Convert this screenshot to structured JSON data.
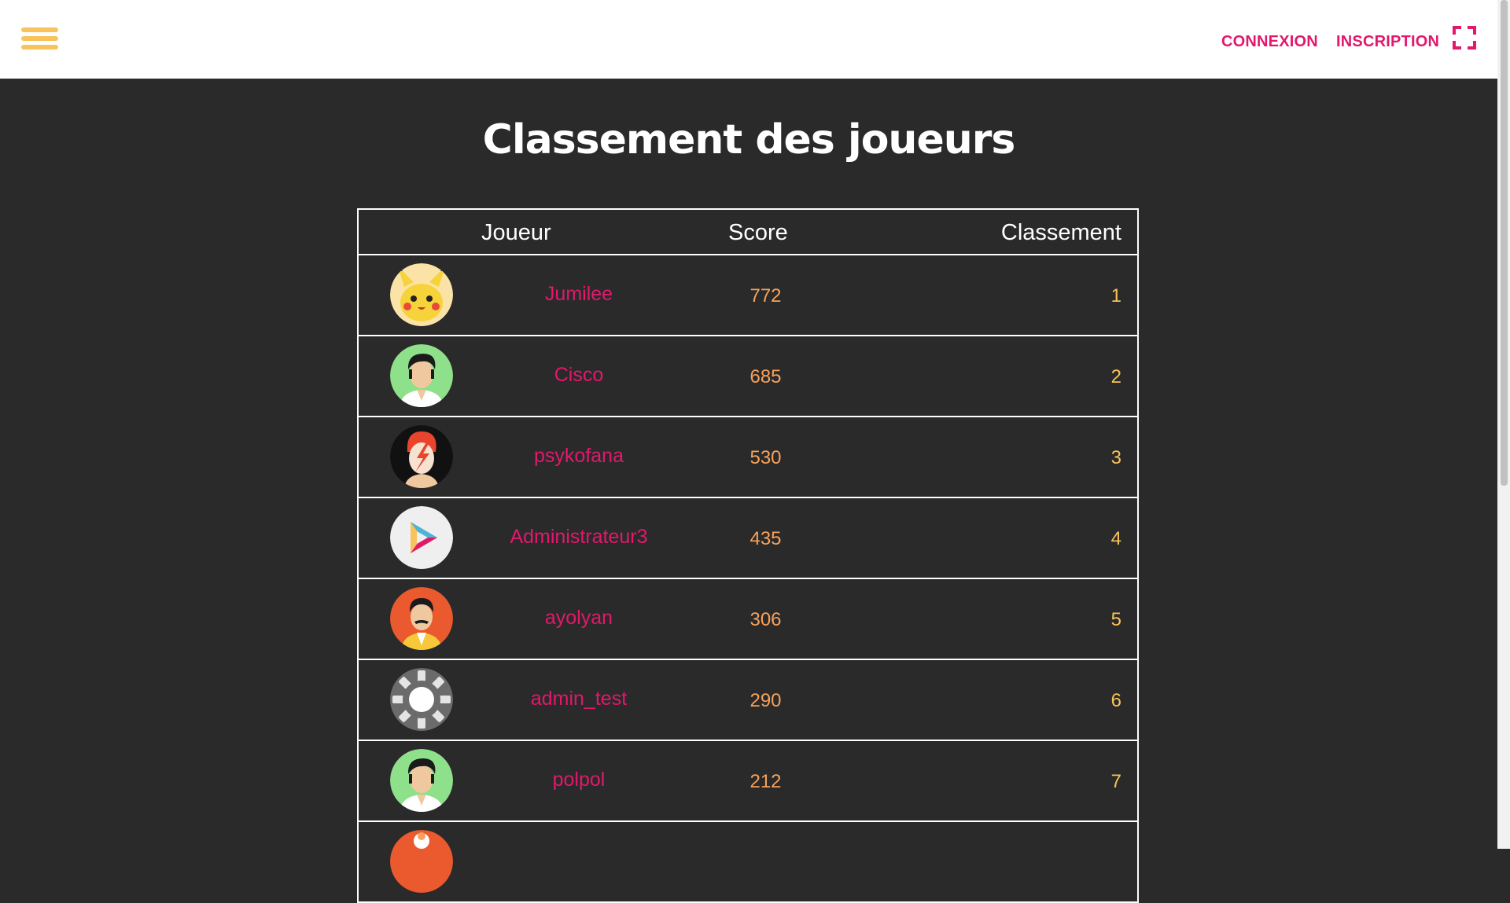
{
  "header": {
    "menu_icon": "hamburger-menu-icon",
    "login_label": "CONNEXION",
    "signup_label": "INSCRIPTION",
    "fullscreen_icon": "fullscreen-icon",
    "accent_color": "#e2186d",
    "menu_color": "#f7c35a"
  },
  "page": {
    "title": "Classement des joueurs",
    "background_color": "#2a2a2a"
  },
  "table": {
    "columns": [
      "Joueur",
      "Score",
      "Classement"
    ],
    "rows": [
      {
        "player": "Jumilee",
        "score": "772",
        "rank": "1",
        "avatar": "pikachu-avatar"
      },
      {
        "player": "Cisco",
        "score": "685",
        "rank": "2",
        "avatar": "elvis-avatar"
      },
      {
        "player": "psykofana",
        "score": "530",
        "rank": "3",
        "avatar": "bowie-avatar"
      },
      {
        "player": "Administrateur3",
        "score": "435",
        "rank": "4",
        "avatar": "play-logo-avatar"
      },
      {
        "player": "ayolyan",
        "score": "306",
        "rank": "5",
        "avatar": "freddie-avatar"
      },
      {
        "player": "admin_test",
        "score": "290",
        "rank": "6",
        "avatar": "gear-avatar"
      },
      {
        "player": "polpol",
        "score": "212",
        "rank": "7",
        "avatar": "elvis-avatar"
      },
      {
        "player": "",
        "score": "",
        "rank": "",
        "avatar": "orange-avatar"
      }
    ]
  }
}
